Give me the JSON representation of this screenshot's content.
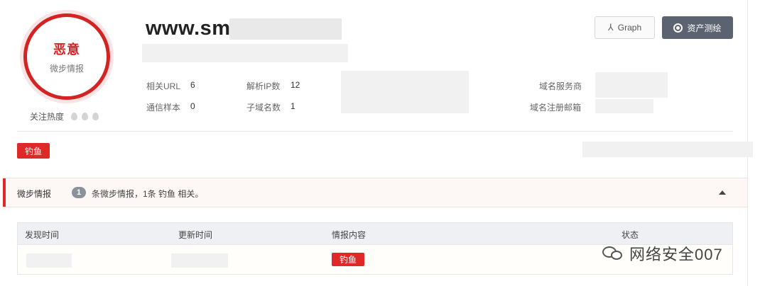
{
  "verdict": {
    "level": "恶意",
    "source": "微步情报"
  },
  "heat": {
    "label": "关注热度",
    "icon": "flame-icon"
  },
  "domain": {
    "title": "www.sm"
  },
  "info": {
    "related_url": {
      "label": "相关URL",
      "value": "6"
    },
    "resolved_ip": {
      "label": "解析IP数",
      "value": "12"
    },
    "samples": {
      "label": "通信样本",
      "value": "0"
    },
    "subdomains": {
      "label": "子域名数",
      "value": "1"
    },
    "registrar": {
      "label": "域名服务商"
    },
    "registrant_email": {
      "label": "域名注册邮箱"
    }
  },
  "buttons": {
    "graph": "Graph",
    "asset": "资产测绘"
  },
  "tags": {
    "phishing": "钓鱼"
  },
  "intel": {
    "title": "微步情报",
    "count": "1",
    "summary": "条微步情报，1条 钓鱼 相关。"
  },
  "table": {
    "columns": [
      "发现时间",
      "更新时间",
      "情报内容",
      "状态"
    ],
    "rows": [
      {
        "content_tag": "钓鱼"
      }
    ]
  },
  "watermark": {
    "text": "网络安全007"
  },
  "colors": {
    "danger": "#e02828",
    "dark_button": "#5b6370"
  }
}
